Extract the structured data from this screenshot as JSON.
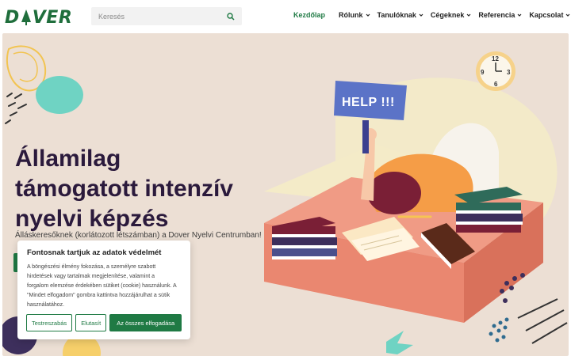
{
  "header": {
    "logo_text": "DOVER",
    "search": {
      "placeholder": "Keresés",
      "value": ""
    },
    "nav": [
      {
        "label": "Kezdőlap",
        "active": true,
        "has_dropdown": false
      },
      {
        "label": "Rólunk",
        "active": false,
        "has_dropdown": true
      },
      {
        "label": "Tanulóknak",
        "active": false,
        "has_dropdown": true
      },
      {
        "label": "Cégeknek",
        "active": false,
        "has_dropdown": true
      },
      {
        "label": "Referencia",
        "active": false,
        "has_dropdown": true
      },
      {
        "label": "Kapcsolat",
        "active": false,
        "has_dropdown": true
      }
    ]
  },
  "hero": {
    "title_lines": [
      "Államilag",
      "támogatott intenzív",
      "nyelvi képzés"
    ],
    "subtitle": "Álláskeresőknek (korlátozott létszámban) a Dover Nyelvi Centrumban!",
    "sign_text": "HELP !!!",
    "clock_numbers": [
      "12",
      "3",
      "6",
      "9"
    ]
  },
  "cookie_banner": {
    "title": "Fontosnak tartjuk az adatok védelmét",
    "text_lines": [
      "A böngészési élmény fokozása, a személyre szabott",
      "hirdetések vagy tartalmak megjelenítése, valamint a",
      "forgalom elemzése érdekében sütiket (cookie) használunk. A",
      "\"Mindet elfogadom\" gombra kattintva hozzájárulhat a sütik",
      "használatához."
    ],
    "buttons": {
      "customize": "Testreszabás",
      "reject": "Elutasít",
      "accept_all": "Az összes elfogadása"
    }
  },
  "colors": {
    "brand_green": "#1f7a44",
    "hero_bg": "#ecdfd4",
    "title_color": "#2b1a3c",
    "desk": "#ee8c76",
    "sign": "#5b73c7"
  },
  "icons": [
    "search-icon",
    "chevron-down-icon",
    "logo-tree-icon",
    "clock-icon"
  ]
}
